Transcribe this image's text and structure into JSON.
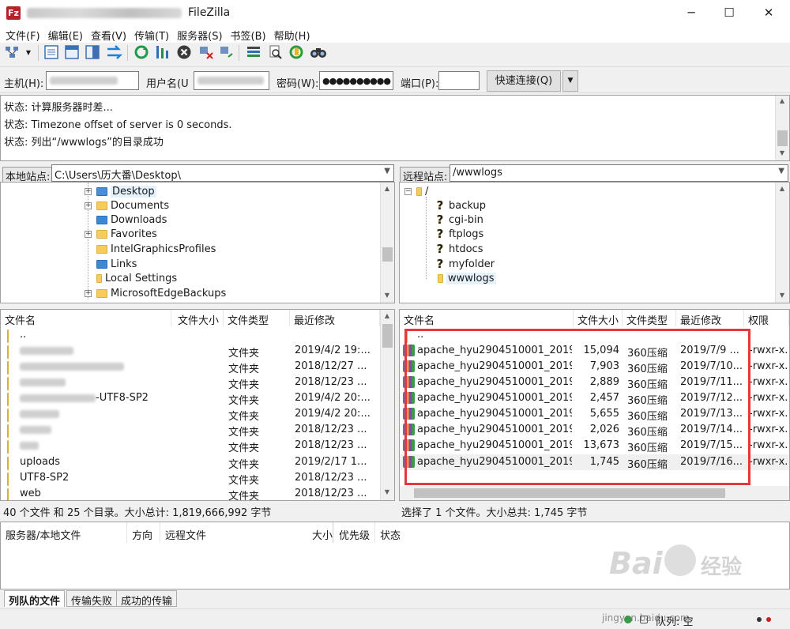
{
  "window": {
    "app_icon": "Fz",
    "title": "FileZilla",
    "minimize": "─",
    "maximize": "☐",
    "close": "✕"
  },
  "menu": [
    "文件(F)",
    "编辑(E)",
    "查看(V)",
    "传输(T)",
    "服务器(S)",
    "书签(B)",
    "帮助(H)"
  ],
  "toolbar": {
    "icons": [
      "site-manager-icon",
      "dropdown-arrow-icon",
      "toggle-log-icon",
      "toggle-local-tree-icon",
      "toggle-remote-tree-icon",
      "toggle-queue-icon",
      "refresh-icon",
      "process-queue-icon",
      "cancel-icon",
      "disconnect-icon",
      "reconnect-icon",
      "filter-icon",
      "search-icon",
      "sync-browse-icon",
      "compare-icon"
    ]
  },
  "quickconnect": {
    "host_label": "主机(H):",
    "user_label": "用户名(U",
    "password_label": "密码(W):",
    "password_value": "●●●●●●●●●●",
    "port_label": "端口(P):",
    "port_value": "",
    "connect_button": "快速连接(Q)",
    "dropdown": "▼"
  },
  "log": [
    "状态: 计算服务器时差...",
    "状态: Timezone offset of server is 0 seconds.",
    "状态: 列出“/wwwlogs”的目录成功"
  ],
  "local": {
    "site_label": "本地站点:",
    "path": "C:\\Users\\历大番\\Desktop\\",
    "tree": [
      {
        "name": "Desktop",
        "expander": "+"
      },
      {
        "name": "Documents",
        "expander": "+"
      },
      {
        "name": "Downloads",
        "expander": ""
      },
      {
        "name": "Favorites",
        "expander": "+"
      },
      {
        "name": "IntelGraphicsProfiles",
        "expander": ""
      },
      {
        "name": "Links",
        "expander": ""
      },
      {
        "name": "Local Settings",
        "expander": ""
      },
      {
        "name": "MicrosoftEdgeBackups",
        "expander": "+"
      }
    ],
    "columns": [
      "文件名",
      "文件大小",
      "文件类型",
      "最近修改"
    ],
    "files": [
      {
        "name": "..",
        "size": "",
        "type": "",
        "modified": ""
      },
      {
        "name": "",
        "size": "",
        "type": "文件夹",
        "modified": "2019/4/2 19:..."
      },
      {
        "name": "",
        "size": "",
        "type": "文件夹",
        "modified": "2018/12/27 ..."
      },
      {
        "name": "",
        "size": "",
        "type": "文件夹",
        "modified": "2018/12/23 ..."
      },
      {
        "name": "-UTF8-SP2",
        "size": "",
        "type": "文件夹",
        "modified": "2019/4/2 20:..."
      },
      {
        "name": "",
        "size": "",
        "type": "文件夹",
        "modified": "2019/4/2 20:..."
      },
      {
        "name": "",
        "size": "",
        "type": "文件夹",
        "modified": "2018/12/23 ..."
      },
      {
        "name": "",
        "size": "",
        "type": "文件夹",
        "modified": "2018/12/23 ..."
      },
      {
        "name": "uploads",
        "size": "",
        "type": "文件夹",
        "modified": "2019/2/17 1..."
      },
      {
        "name": "UTF8-SP2",
        "size": "",
        "type": "文件夹",
        "modified": "2018/12/23 ..."
      },
      {
        "name": "web",
        "size": "",
        "type": "文件夹",
        "modified": "2018/12/23 ..."
      }
    ],
    "status": "40 个文件 和 25 个目录。大小总计: 1,819,666,992 字节"
  },
  "remote": {
    "site_label": "远程站点:",
    "path": "/wwwlogs",
    "tree": [
      {
        "name": "/",
        "icon": "folder"
      },
      {
        "name": "backup",
        "icon": "question"
      },
      {
        "name": "cgi-bin",
        "icon": "question"
      },
      {
        "name": "ftplogs",
        "icon": "question"
      },
      {
        "name": "htdocs",
        "icon": "question"
      },
      {
        "name": "myfolder",
        "icon": "question"
      },
      {
        "name": "wwwlogs",
        "icon": "folder"
      }
    ],
    "columns": [
      "文件名",
      "文件大小",
      "文件类型",
      "最近修改",
      "权限"
    ],
    "files": [
      {
        "name": "..",
        "size": "",
        "type": "",
        "modified": "",
        "perm": ""
      },
      {
        "name": "apache_hyu2904510001_2019...",
        "size": "15,094",
        "type": "360压缩",
        "modified": "2019/7/9 ...",
        "perm": "-rwxr-x..."
      },
      {
        "name": "apache_hyu2904510001_2019...",
        "size": "7,903",
        "type": "360压缩",
        "modified": "2019/7/10...",
        "perm": "-rwxr-x..."
      },
      {
        "name": "apache_hyu2904510001_2019...",
        "size": "2,889",
        "type": "360压缩",
        "modified": "2019/7/11...",
        "perm": "-rwxr-x..."
      },
      {
        "name": "apache_hyu2904510001_2019...",
        "size": "2,457",
        "type": "360压缩",
        "modified": "2019/7/12...",
        "perm": "-rwxr-x..."
      },
      {
        "name": "apache_hyu2904510001_2019...",
        "size": "5,655",
        "type": "360压缩",
        "modified": "2019/7/13...",
        "perm": "-rwxr-x..."
      },
      {
        "name": "apache_hyu2904510001_2019...",
        "size": "2,026",
        "type": "360压缩",
        "modified": "2019/7/14...",
        "perm": "-rwxr-x..."
      },
      {
        "name": "apache_hyu2904510001_2019...",
        "size": "13,673",
        "type": "360压缩",
        "modified": "2019/7/15...",
        "perm": "-rwxr-x..."
      },
      {
        "name": "apache_hyu2904510001_2019...",
        "size": "1,745",
        "type": "360压缩",
        "modified": "2019/7/16...",
        "perm": "-rwxr-x..."
      }
    ],
    "status": "选择了 1 个文件。大小总共: 1,745 字节"
  },
  "queue": {
    "columns": [
      "服务器/本地文件",
      "方向",
      "远程文件",
      "大小",
      "优先级",
      "状态"
    ],
    "tabs": [
      "列队的文件",
      "传输失败",
      "成功的传输"
    ],
    "status": "队列: 空"
  },
  "watermark": {
    "brand": "Bai",
    "brand_cn": "经验",
    "url": "jingyan.baidu.com"
  },
  "colors": {
    "highlight": "#e5383b",
    "folder": "#f6cd5c",
    "accent": "#0078d7"
  }
}
